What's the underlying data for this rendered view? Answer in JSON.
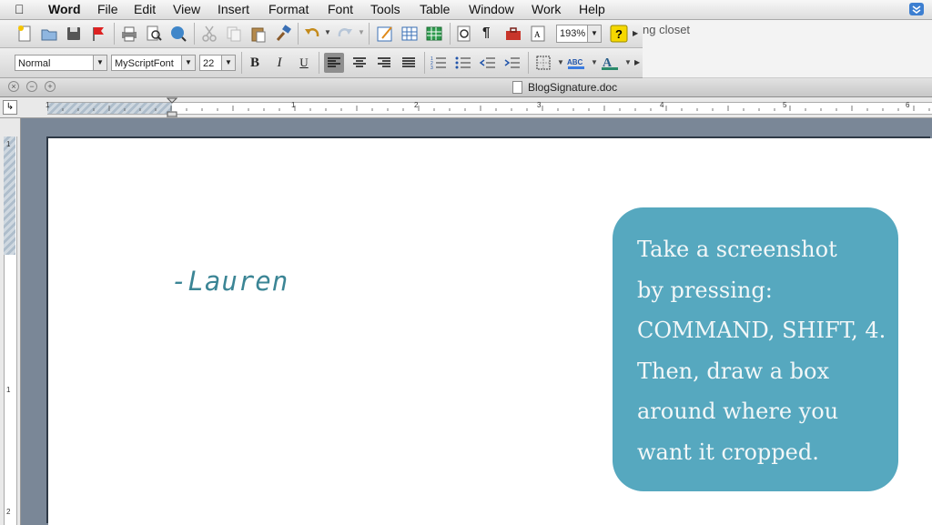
{
  "menubar": {
    "app_name": "Word",
    "items": [
      "File",
      "Edit",
      "View",
      "Insert",
      "Format",
      "Font",
      "Tools",
      "Table",
      "Window",
      "Work",
      "Help"
    ]
  },
  "toolbar": {
    "zoom": "193%",
    "style": "Normal",
    "font": "MyScriptFont",
    "size": "22",
    "bold": "B",
    "italic": "I",
    "underline": "U",
    "pilcrow": "¶",
    "help": "?"
  },
  "background_window": {
    "partial_title": "ng closet"
  },
  "document": {
    "title": "BlogSignature.doc",
    "signature": "-Lauren",
    "callout_lines": [
      "Take a screenshot",
      "by pressing:",
      "COMMAND, SHIFT, 4.",
      "Then, draw a box",
      "around where you",
      "want it cropped."
    ],
    "callout_color": "#56a8bf",
    "signature_color": "#3b8595"
  },
  "ruler": {
    "numbers": [
      "1",
      "1",
      "2",
      "3",
      "4",
      "5",
      "6"
    ],
    "vertical_numbers": [
      "1",
      "1",
      "2"
    ]
  }
}
